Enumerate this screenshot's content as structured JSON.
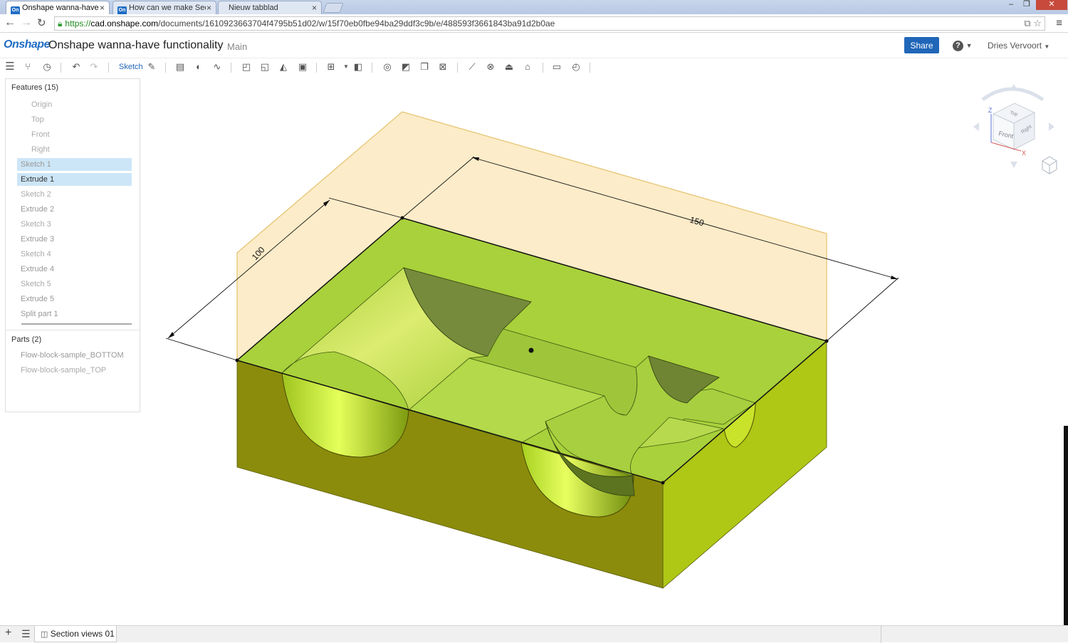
{
  "browser": {
    "tabs": [
      {
        "title": "Onshape wanna-have fun",
        "favicon": "On",
        "active": true
      },
      {
        "title": "How can we make Section",
        "favicon": "On",
        "active": false
      },
      {
        "title": "Nieuw tabblad",
        "favicon": "",
        "active": false
      }
    ],
    "url": {
      "scheme": "https://",
      "host": "cad.onshape.com",
      "path": "/documents/1610923663704f4795b51d02/w/15f70eb0fbe94ba29ddf3c9b/e/488593f3661843ba91d2b0ae"
    }
  },
  "header": {
    "logo": "Onshape",
    "document_title": "Onshape wanna-have functionality",
    "workspace": "Main",
    "share_label": "Share",
    "user": "Dries Vervoort"
  },
  "toolbar": {
    "sketch_label": "Sketch"
  },
  "feature_panel": {
    "features_header": "Features (15)",
    "features": [
      {
        "label": "Origin"
      },
      {
        "label": "Top"
      },
      {
        "label": "Front"
      },
      {
        "label": "Right"
      },
      {
        "label": "Sketch 1"
      },
      {
        "label": "Extrude 1"
      },
      {
        "label": "Sketch 2"
      },
      {
        "label": "Extrude 2"
      },
      {
        "label": "Sketch 3"
      },
      {
        "label": "Extrude 3"
      },
      {
        "label": "Sketch 4"
      },
      {
        "label": "Extrude 4"
      },
      {
        "label": "Sketch 5"
      },
      {
        "label": "Extrude 5"
      },
      {
        "label": "Split part 1"
      }
    ],
    "parts_header": "Parts (2)",
    "parts": [
      {
        "label": "Flow-block-sample_BOTTOM"
      },
      {
        "label": "Flow-block-sample_TOP"
      }
    ]
  },
  "viewport": {
    "dimensions": {
      "width": "150",
      "depth": "100"
    },
    "view_cube": {
      "top": "Top",
      "front": "Front",
      "right": "Right",
      "axis_z": "Z",
      "axis_x": "X"
    }
  },
  "bottom_bar": {
    "tab_label": "Section views 01"
  },
  "colors": {
    "accent": "#2066b8",
    "part_top": "#a9d13b",
    "part_front": "#8b8c0c",
    "part_side": "#afc715",
    "plane": "#fde9c0",
    "selection": "#cde6f7"
  }
}
